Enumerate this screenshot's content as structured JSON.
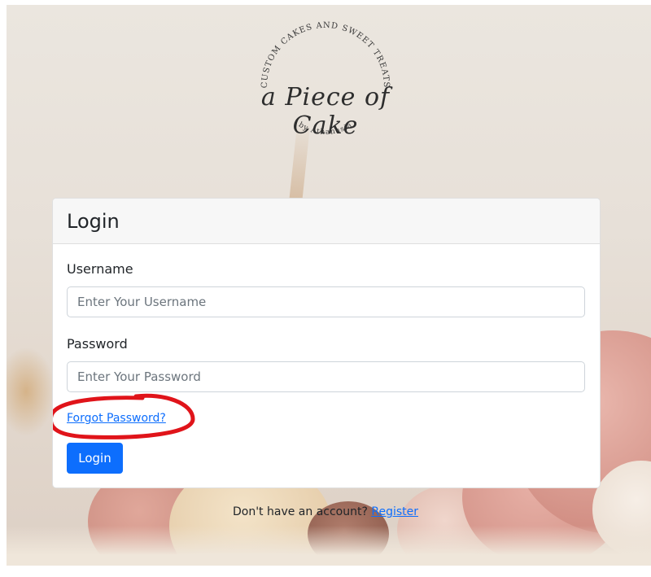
{
  "logo": {
    "arc_top": "CUSTOM CAKES AND SWEET TREATS",
    "script": "a Piece of Cake",
    "arc_bottom": "by Athanasia"
  },
  "login_card": {
    "title": "Login",
    "username_label": "Username",
    "username_placeholder": "Enter Your Username",
    "password_label": "Password",
    "password_placeholder": "Enter Your Password",
    "forgot_link": "Forgot Password?",
    "login_button": "Login"
  },
  "register": {
    "prompt": "Don't have an account?",
    "link": "Register"
  },
  "colors": {
    "accent": "#0d6efd",
    "annotation": "#e0141a"
  }
}
